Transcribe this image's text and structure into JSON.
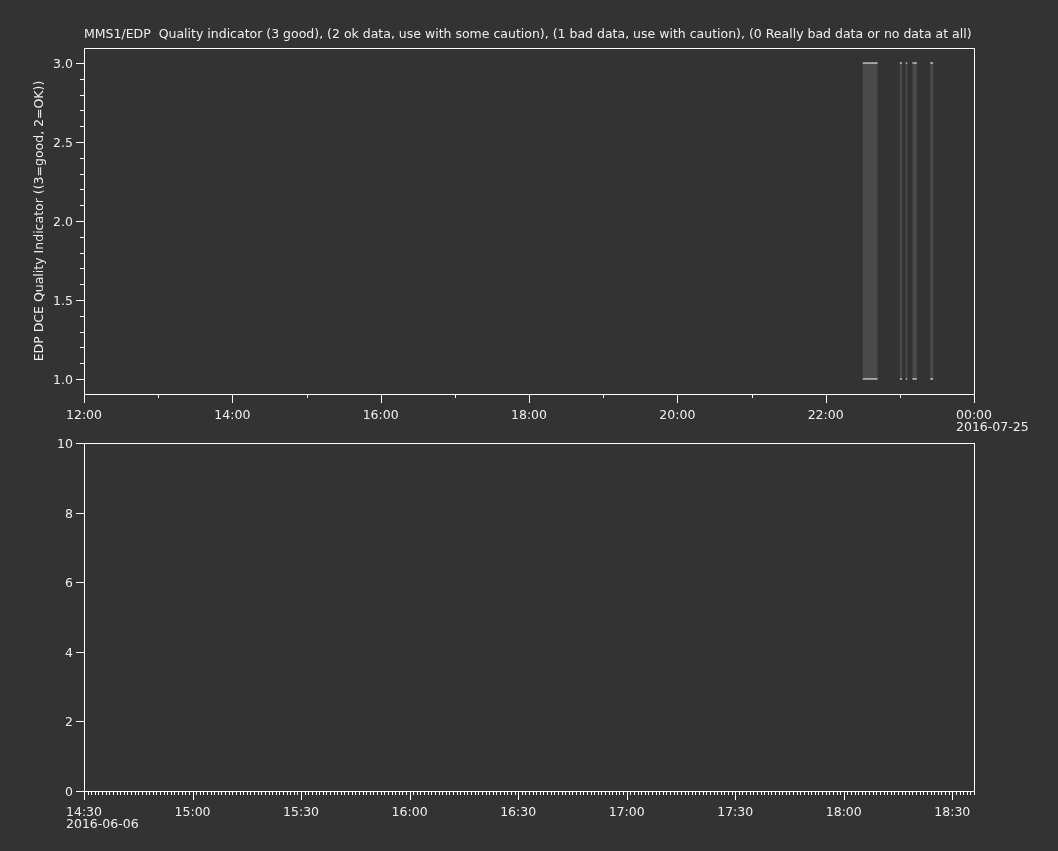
{
  "plots": [
    {
      "title": "MMS1/EDP  Quality indicator (3 good), (2 ok data, use with some caution), (1 bad data, use with caution), (0 Really bad data or no data at all)",
      "date_label": "2016-07-25",
      "chart_data": {
        "type": "area",
        "ylabel": "EDP DCE Quality Indicator ((3=good, 2=OK))",
        "x": [
          22.5,
          22.7,
          null,
          23.0,
          23.03,
          null,
          23.08,
          23.1,
          null,
          23.17,
          23.23,
          null,
          23.41,
          23.45
        ],
        "series": [
          {
            "color": "#4a4a4a",
            "values": [
              3,
              3,
              null,
              3,
              3,
              null,
              3,
              3,
              null,
              3,
              3,
              null,
              3,
              3
            ]
          }
        ],
        "xlim": [
          12,
          24
        ],
        "ylim": [
          0.905,
          3.095
        ],
        "xticks": [
          {
            "value": 12,
            "label": "12:00"
          },
          {
            "value": 14,
            "label": "14:00"
          },
          {
            "value": 16,
            "label": "16:00"
          },
          {
            "value": 18,
            "label": "18:00"
          },
          {
            "value": 20,
            "label": "20:00"
          },
          {
            "value": 22,
            "label": "22:00"
          },
          {
            "value": 24,
            "label": "00:00"
          }
        ],
        "yticks": [
          {
            "value": 1,
            "label": "1.0"
          },
          {
            "value": 1.5,
            "label": "1.5"
          },
          {
            "value": 2,
            "label": "2.0"
          },
          {
            "value": 2.5,
            "label": "2.5"
          },
          {
            "value": 3,
            "label": "3.0"
          }
        ]
      }
    },
    {
      "date_label": "2016-06-06",
      "chart_data": {
        "type": "line",
        "xlim": [
          14.5,
          18.6
        ],
        "ylim": [
          0,
          10
        ],
        "xticks": [
          {
            "value": 14.5,
            "label": "14:30"
          },
          {
            "value": 15,
            "label": "15:00"
          },
          {
            "value": 15.5,
            "label": "15:30"
          },
          {
            "value": 16,
            "label": "16:00"
          },
          {
            "value": 16.5,
            "label": "16:30"
          },
          {
            "value": 17,
            "label": "17:00"
          },
          {
            "value": 17.5,
            "label": "17:30"
          },
          {
            "value": 18,
            "label": "18:00"
          },
          {
            "value": 18.5,
            "label": "18:30"
          }
        ],
        "yticks": [
          0,
          2,
          4,
          6,
          8,
          10
        ]
      }
    }
  ]
}
